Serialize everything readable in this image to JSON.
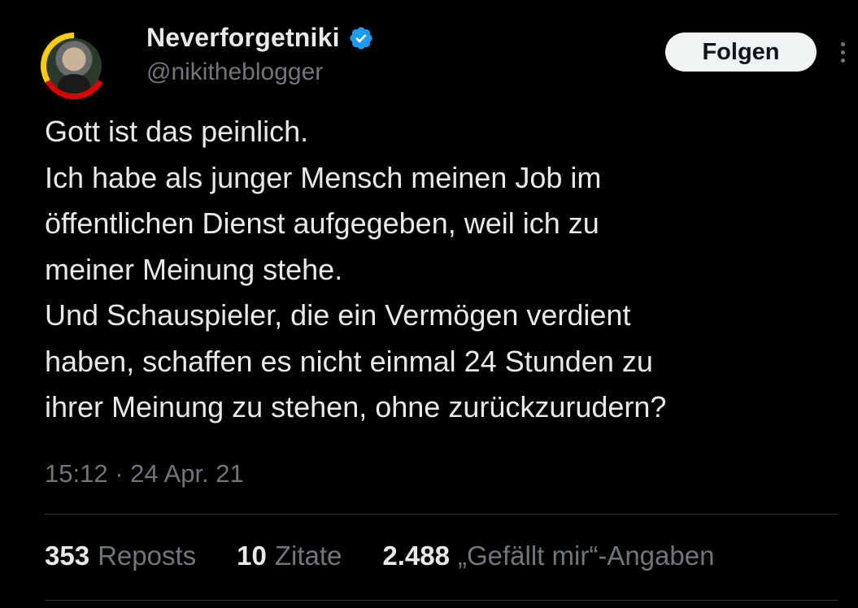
{
  "author": {
    "display_name": "Neverforgetniki",
    "handle": "@nikitheblogger",
    "verified_icon": "verified-badge-icon",
    "avatar": "profile-photo"
  },
  "follow_button": {
    "label": "Folgen"
  },
  "more_button": {
    "icon": "more-vertical-icon"
  },
  "tweet": {
    "lines": [
      "Gott ist das peinlich.",
      "Ich habe als junger Mensch meinen Job im",
      "öffentlichen Dienst aufgegeben, weil ich zu",
      "meiner Meinung stehe.",
      "Und Schauspieler, die ein Vermögen verdient",
      "haben, schaffen es nicht einmal 24 Stunden zu",
      "ihrer Meinung zu stehen, ohne zurückzurudern?"
    ],
    "time": "15:12",
    "separator": " · ",
    "date": "24 Apr. 21"
  },
  "stats": [
    {
      "count": "353",
      "label": "Reposts"
    },
    {
      "count": "10",
      "label": "Zitate"
    },
    {
      "count": "2.488",
      "label": "„Gefällt mir“-Angaben"
    }
  ],
  "colors": {
    "background": "#000000",
    "text": "#e7e9ea",
    "secondary_text": "#71767b",
    "verified": "#1d9bf0",
    "button_bg": "#eff3f4",
    "divider": "#2f3336"
  }
}
